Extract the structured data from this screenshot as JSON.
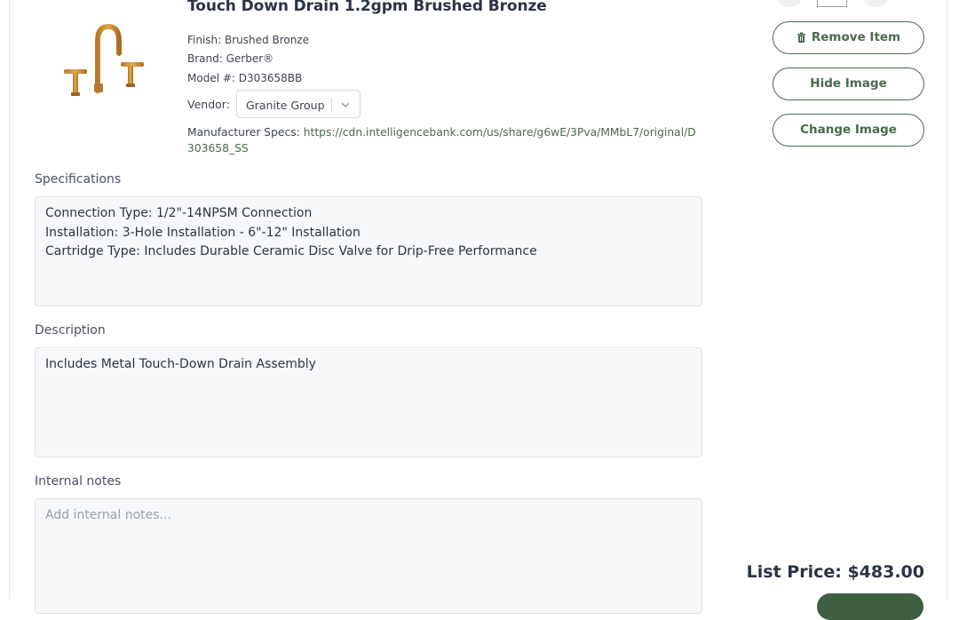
{
  "product": {
    "title": "Touch Down Drain 1.2gpm Brushed Bronze",
    "finish": "Finish: Brushed Bronze",
    "brand": "Brand: Gerber®",
    "model": "Model #: D303658BB",
    "vendor_label": "Vendor:",
    "vendor_value": "Granite Group",
    "specs_label": "Manufacturer Specs:",
    "specs_url": "https://cdn.intelligencebank.com/us/share/g6wE/3Pva/MMbL7/original/D303658_SS",
    "image_icon": "faucet-image"
  },
  "specifications": {
    "label": "Specifications",
    "lines": [
      "Connection Type: 1/2\"-14NPSM Connection",
      "Installation: 3-Hole Installation - 6\"-12\" Installation",
      "Cartridge Type: Includes Durable Ceramic Disc Valve for Drip-Free Performance"
    ]
  },
  "description": {
    "label": "Description",
    "text": "Includes Metal Touch-Down Drain Assembly"
  },
  "internal_notes": {
    "label": "Internal notes",
    "placeholder": "Add internal notes..."
  },
  "actions": {
    "remove": "Remove Item",
    "hide_image": "Hide Image",
    "change_image": "Change Image"
  },
  "pricing": {
    "list_price": "List Price: $483.00"
  },
  "colors": {
    "accent": "#4a6a4e",
    "title": "#2b3445"
  }
}
